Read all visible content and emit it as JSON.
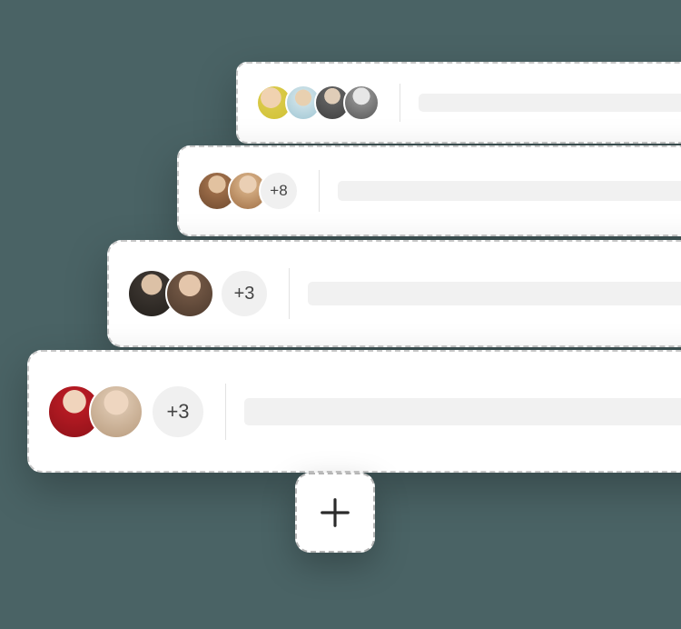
{
  "cards": [
    {
      "avatars": [
        {
          "name": "avatar-1",
          "cls": "av-a"
        },
        {
          "name": "avatar-2",
          "cls": "av-b"
        },
        {
          "name": "avatar-3",
          "cls": "av-c"
        },
        {
          "name": "avatar-4",
          "cls": "av-d"
        }
      ],
      "overflow": null
    },
    {
      "avatars": [
        {
          "name": "avatar-1",
          "cls": "av-e"
        },
        {
          "name": "avatar-2",
          "cls": "av-f"
        }
      ],
      "overflow": "+8"
    },
    {
      "avatars": [
        {
          "name": "avatar-1",
          "cls": "av-g"
        },
        {
          "name": "avatar-2",
          "cls": "av-h"
        }
      ],
      "overflow": "+3"
    },
    {
      "avatars": [
        {
          "name": "avatar-1",
          "cls": "av-i"
        },
        {
          "name": "avatar-2",
          "cls": "av-j"
        }
      ],
      "overflow": "+3"
    }
  ],
  "add_button": {
    "icon": "plus-icon"
  }
}
